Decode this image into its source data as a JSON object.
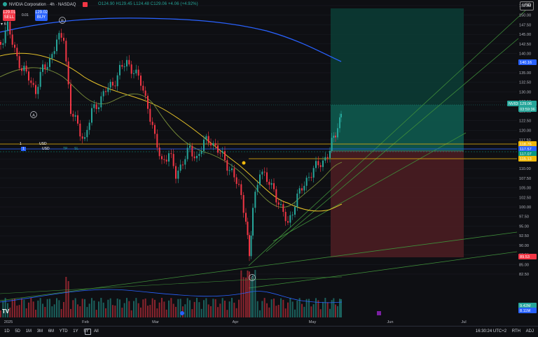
{
  "header": {
    "symbol_title": "NVIDIA Corporation · 4h · NASDAQ",
    "ohlc_text": "O124.90 H129.45 L124.48 C129.06 +4.06 (+4.92%)",
    "currency_badge": "USD",
    "sell_price": "129.01",
    "sell_label": "SELL",
    "buy_price": "129.02",
    "buy_label": "BUY",
    "spread": "0.01",
    "side_arrow": "▾ 6"
  },
  "price_axis": {
    "ticks": [
      "152.50",
      "150.00",
      "147.50",
      "145.00",
      "142.50",
      "140.00",
      "137.50",
      "135.00",
      "132.50",
      "130.00",
      "127.50",
      "125.00",
      "122.50",
      "120.00",
      "117.50",
      "115.00",
      "112.50",
      "110.00",
      "107.50",
      "105.00",
      "102.50",
      "100.00",
      "97.50",
      "95.00",
      "92.50",
      "90.00",
      "87.50",
      "85.00",
      "82.50"
    ],
    "tags": [
      {
        "text": "140.16",
        "color": "#2962ff"
      },
      {
        "text": "NVIDIA",
        "color": "#26a69a"
      },
      {
        "text": "129.06",
        "color": "#26a69a"
      },
      {
        "text": "03:59:36",
        "color": "#26a69a"
      },
      {
        "text": "118.76",
        "color": "#f0b90b"
      },
      {
        "text": "117.57",
        "color": "#2962ff"
      },
      {
        "text": "117.07",
        "color": "#089981"
      },
      {
        "text": "115.13",
        "color": "#f0b90b"
      },
      {
        "text": "89.53",
        "color": "#f23645"
      },
      {
        "text": "9.42M",
        "color": "#26a69a"
      },
      {
        "text": "8.11M",
        "color": "#2962ff"
      }
    ]
  },
  "time_axis": {
    "labels": [
      "2025",
      "Feb",
      "Mar",
      "Apr",
      "May",
      "Jun",
      "Jul"
    ]
  },
  "order_lines": {
    "line1_qty": "1",
    "line1_ccy": "USD",
    "line2_qty": "1",
    "line2_ccy": "USD",
    "tp_label": "TP",
    "sl_label": "SL"
  },
  "annotations": {
    "wave_a": "A",
    "wave_b": "B",
    "wave_c": "C"
  },
  "bottom": {
    "ranges": [
      "1D",
      "5D",
      "1M",
      "3M",
      "6M",
      "YTD",
      "1Y",
      "5Y",
      "All"
    ],
    "clock": "16:30:24 UTC+2",
    "session": "RTH",
    "adj": "ADJ"
  },
  "colors": {
    "up": "#26a69a",
    "down": "#f23645",
    "ma_blue": "#2962ff",
    "ma_yellow": "#e6c229",
    "ma_green": "#4caf50"
  },
  "icons": [
    "close-icon",
    "calendar-icon",
    "chevron-down-icon",
    "tradingview-logo-icon"
  ]
}
